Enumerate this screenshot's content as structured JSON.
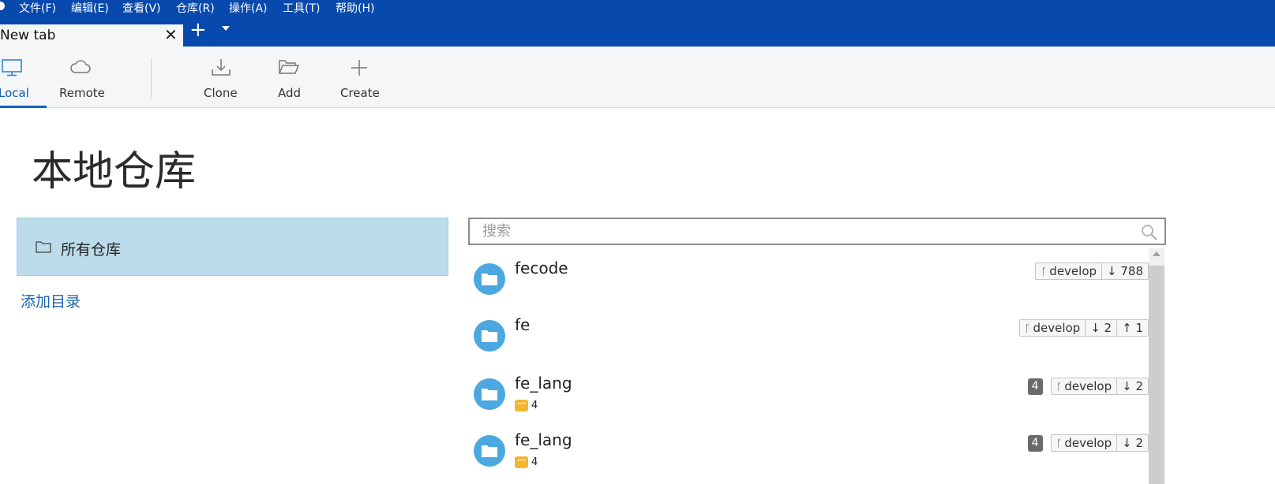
{
  "menu": [
    "文件(F)",
    "编辑(E)",
    "查看(V)",
    "仓库(R)",
    "操作(A)",
    "工具(T)",
    "帮助(H)"
  ],
  "tab": {
    "title": "New tab",
    "close": "✕",
    "add": "+"
  },
  "toolbar": {
    "local": "Local",
    "remote": "Remote",
    "clone": "Clone",
    "add": "Add",
    "create": "Create"
  },
  "page_title": "本地仓库",
  "sidebar": {
    "all_repos": "所有仓库",
    "add_directory": "添加目录"
  },
  "search": {
    "placeholder": "搜索",
    "value": ""
  },
  "repos": [
    {
      "name": "fecode",
      "stash": null,
      "count": null,
      "branch": "develop",
      "behind": "↓ 788",
      "ahead": null
    },
    {
      "name": "fe",
      "stash": null,
      "count": null,
      "branch": "develop",
      "behind": "↓ 2",
      "ahead": "↑ 1"
    },
    {
      "name": "fe_lang",
      "stash": "4",
      "count": "4",
      "branch": "develop",
      "behind": "↓ 2",
      "ahead": null
    },
    {
      "name": "fe_lang",
      "stash": "4",
      "count": "4",
      "branch": "develop",
      "behind": "↓ 2",
      "ahead": null
    }
  ],
  "colors": {
    "titlebar": "#0749ac",
    "accent": "#1162c2",
    "repo_icon": "#4ca8e0",
    "selected": "#bcdcec",
    "stash": "#f2b630"
  }
}
